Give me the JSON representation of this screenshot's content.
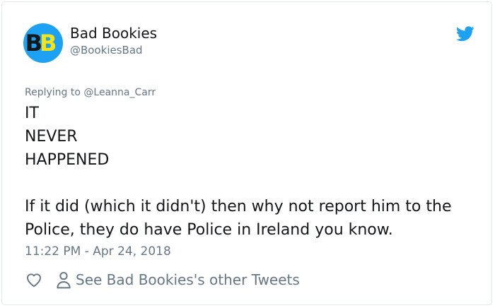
{
  "tweet": {
    "author_name": "Bad Bookies",
    "author_handle": "@BookiesBad",
    "avatar_letters": [
      "B",
      "B"
    ],
    "replying_prefix": "Replying to",
    "replying_to": "@Leanna_Carr",
    "lines": [
      "IT",
      "NEVER",
      "HAPPENED"
    ],
    "paragraph": "If it did (which it didn't) then why not report him to the Police, they do have Police in Ireland you know.",
    "timestamp": "11:22 PM - Apr 24, 2018",
    "other_tweets_label": "See Bad Bookies's other Tweets",
    "icons": {
      "brand": "twitter-bird-icon",
      "like": "heart-icon",
      "profile": "person-icon"
    },
    "colors": {
      "accent": "#1da1f2",
      "muted": "#657786",
      "text": "#14171a",
      "avatar_letter": "#f5e416"
    }
  }
}
